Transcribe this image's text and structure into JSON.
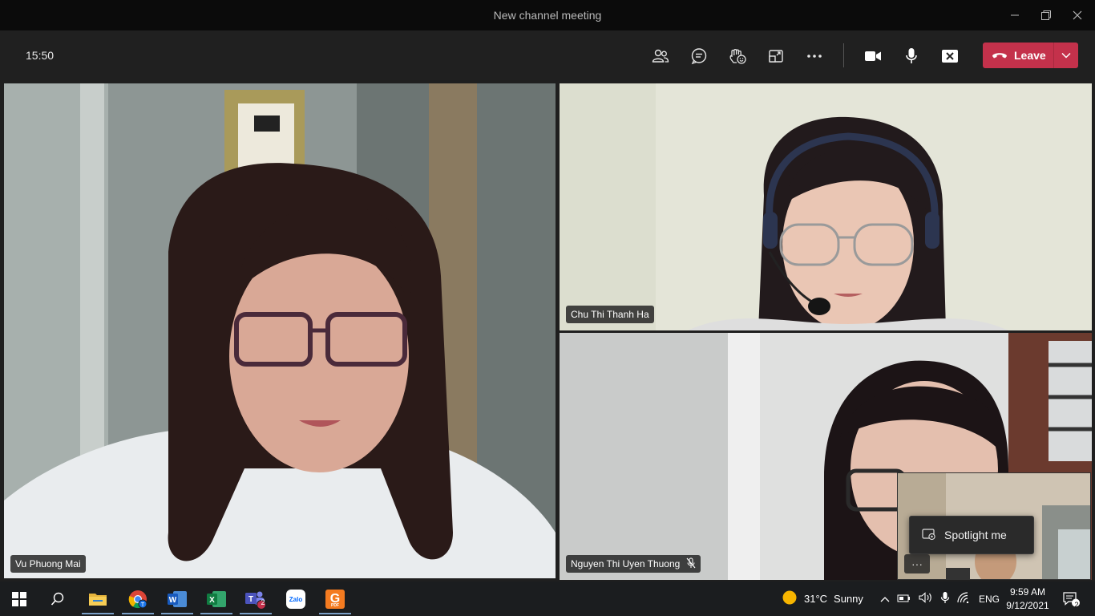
{
  "window": {
    "title": "New channel meeting"
  },
  "toolbar": {
    "time": "15:50",
    "leave_label": "Leave"
  },
  "participants": [
    {
      "name": "Vu Phuong Mai"
    },
    {
      "name": "Chu Thi Thanh Ha"
    },
    {
      "name": "Nguyen Thi Uyen Thuong"
    }
  ],
  "self_menu": {
    "spotlight_label": "Spotlight me",
    "more_label": "···"
  },
  "taskbar": {
    "teams_badge": "2",
    "weather_temp": "31°C",
    "weather_desc": "Sunny",
    "language": "ENG",
    "time": "9:59 AM",
    "date": "9/12/2021",
    "notification_count": "2",
    "zalo_label": "Zalo",
    "foxit_label": "PDF"
  },
  "colors": {
    "accent_outline": "#a7a2ea",
    "leave_red": "#c4314b"
  }
}
